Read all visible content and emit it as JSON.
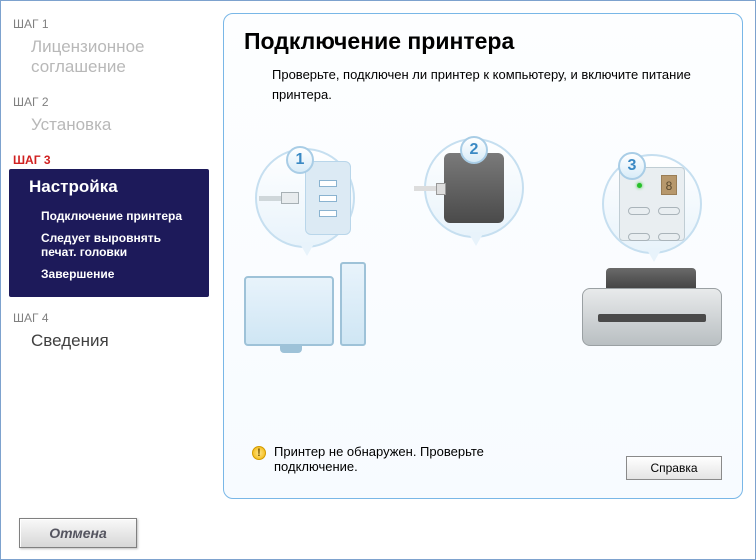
{
  "sidebar": {
    "step1": {
      "label": "ШАГ 1",
      "title": "Лицензионное соглашение"
    },
    "step2": {
      "label": "ШАГ 2",
      "title": "Установка"
    },
    "step3": {
      "label": "ШАГ 3",
      "title": "Настройка",
      "sub": {
        "connect": "Подключение принтера",
        "align": "Следует выровнять печат. головки",
        "finish": "Завершение"
      }
    },
    "step4": {
      "label": "ШАГ 4",
      "title": "Сведения"
    }
  },
  "main": {
    "title": "Подключение принтера",
    "description": "Проверьте, подключен ли принтер к компьютеру, и включите питание принтера.",
    "badges": {
      "b1": "1",
      "b2": "2",
      "b3": "3",
      "disp": "8"
    },
    "warning": "Принтер не обнаружен. Проверьте подключение.",
    "help_label": "Справка"
  },
  "footer": {
    "cancel_label": "Отмена"
  }
}
